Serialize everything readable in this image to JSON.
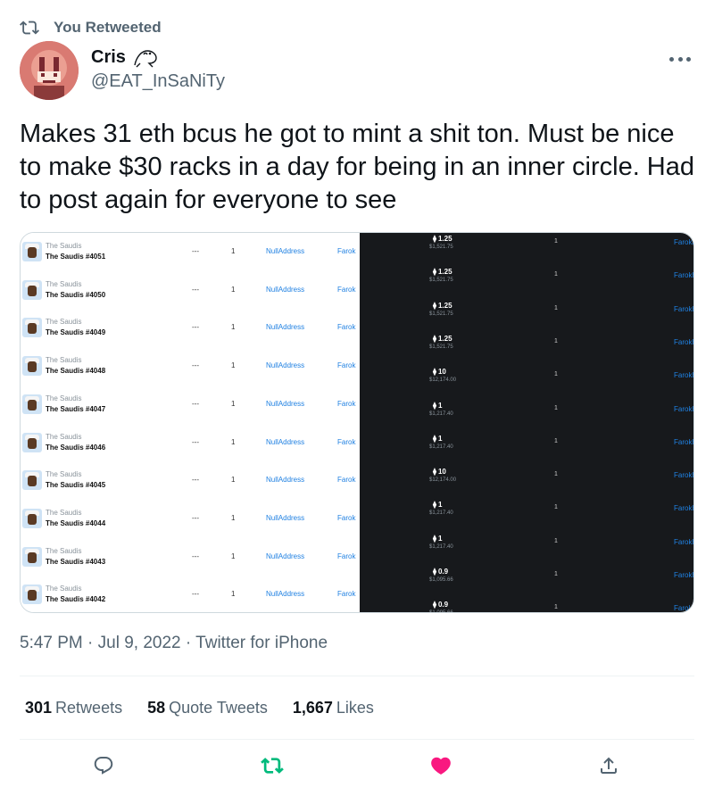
{
  "retweet_banner": {
    "label": "You Retweeted",
    "icon": "retweet-icon"
  },
  "author": {
    "name": "Cris",
    "name_emoji": "frog-icon",
    "handle": "@EAT_InSaNiTy"
  },
  "tweet": {
    "text": "Makes 31 eth bcus he got to mint a shit ton. Must be nice to make $30 racks in a day for being in an inner circle. Had to post again for everyone to see",
    "time": "5:47 PM",
    "separator": "·",
    "date": "Jul 9, 2022",
    "source": "Twitter for iPhone"
  },
  "media": {
    "left_rows": [
      {
        "collection": "The Saudis",
        "item": "The Saudis #4051",
        "price": "---",
        "qty": "1",
        "from": "NullAddress",
        "to": "Farok"
      },
      {
        "collection": "The Saudis",
        "item": "The Saudis #4050",
        "price": "---",
        "qty": "1",
        "from": "NullAddress",
        "to": "Farok"
      },
      {
        "collection": "The Saudis",
        "item": "The Saudis #4049",
        "price": "---",
        "qty": "1",
        "from": "NullAddress",
        "to": "Farok"
      },
      {
        "collection": "The Saudis",
        "item": "The Saudis #4048",
        "price": "---",
        "qty": "1",
        "from": "NullAddress",
        "to": "Farok"
      },
      {
        "collection": "The Saudis",
        "item": "The Saudis #4047",
        "price": "---",
        "qty": "1",
        "from": "NullAddress",
        "to": "Farok"
      },
      {
        "collection": "The Saudis",
        "item": "The Saudis #4046",
        "price": "---",
        "qty": "1",
        "from": "NullAddress",
        "to": "Farok"
      },
      {
        "collection": "The Saudis",
        "item": "The Saudis #4045",
        "price": "---",
        "qty": "1",
        "from": "NullAddress",
        "to": "Farok"
      },
      {
        "collection": "The Saudis",
        "item": "The Saudis #4044",
        "price": "---",
        "qty": "1",
        "from": "NullAddress",
        "to": "Farok"
      },
      {
        "collection": "The Saudis",
        "item": "The Saudis #4043",
        "price": "---",
        "qty": "1",
        "from": "NullAddress",
        "to": "Farok"
      },
      {
        "collection": "The Saudis",
        "item": "The Saudis #4042",
        "price": "---",
        "qty": "1",
        "from": "NullAddress",
        "to": "Farok"
      }
    ],
    "right_rows": [
      {
        "price": "1.25",
        "usd": "$1,521.75",
        "qty": "1",
        "to": "Farokh"
      },
      {
        "price": "1.25",
        "usd": "$1,521.75",
        "qty": "1",
        "to": "Farokh"
      },
      {
        "price": "1.25",
        "usd": "$1,521.75",
        "qty": "1",
        "to": "Farokh"
      },
      {
        "price": "1.25",
        "usd": "$1,521.75",
        "qty": "1",
        "to": "Farokh"
      },
      {
        "price": "10",
        "usd": "$12,174.00",
        "qty": "1",
        "to": "Farokh"
      },
      {
        "price": "1",
        "usd": "$1,217.40",
        "qty": "1",
        "to": "Farokh"
      },
      {
        "price": "1",
        "usd": "$1,217.40",
        "qty": "1",
        "to": "Farokh"
      },
      {
        "price": "10",
        "usd": "$12,174.00",
        "qty": "1",
        "to": "Farokh"
      },
      {
        "price": "1",
        "usd": "$1,217.40",
        "qty": "1",
        "to": "Farokh"
      },
      {
        "price": "1",
        "usd": "$1,217.40",
        "qty": "1",
        "to": "Farokh"
      },
      {
        "price": "0.9",
        "usd": "$1,095.66",
        "qty": "1",
        "to": "Farokh"
      },
      {
        "price": "0.9",
        "usd": "$1,095.66",
        "qty": "1",
        "to": "Farokh"
      }
    ]
  },
  "stats": {
    "retweets_count": "301",
    "retweets_label": "Retweets",
    "quotes_count": "58",
    "quotes_label": "Quote Tweets",
    "likes_count": "1,667",
    "likes_label": "Likes"
  },
  "actions": [
    "reply-icon",
    "retweet-icon",
    "like-icon",
    "share-icon"
  ],
  "colors": {
    "retweet_green": "#00ba7c",
    "like_pink": "#f91880",
    "link_blue": "#2081e2",
    "secondary_text": "#536471"
  }
}
